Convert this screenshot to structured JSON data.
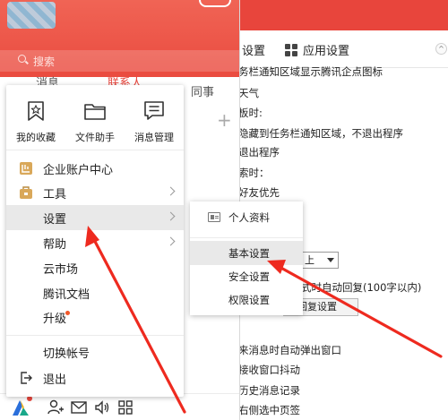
{
  "settings_window": {
    "tab_system": "设置",
    "tab_app": "应用设置",
    "scroll_button": "^",
    "rows": [
      "务栏通知区域显示腾讯企点图标",
      "天气",
      "板时:",
      "隐藏到任务栏通知区域，不退出程序",
      "退出程序",
      "索时：",
      "好友优先",
      "",
      "",
      "",
      "",
      "式时自动回复(100字以内)",
      "",
      "来消息时自动弹出窗口",
      "接收窗口抖动",
      "历史消息记录",
      "右侧选中页签"
    ],
    "select_value": "上",
    "quick_reply_button": "捷回复设置"
  },
  "qq_panel": {
    "search_placeholder": "搜索",
    "tabs": [
      "消息",
      "联系人",
      "同事"
    ]
  },
  "main_menu": {
    "quick_actions": [
      {
        "label": "我的收藏",
        "icon": "bookmark-icon"
      },
      {
        "label": "文件助手",
        "icon": "folder-icon"
      },
      {
        "label": "消息管理",
        "icon": "message-manage-icon"
      }
    ],
    "items": [
      {
        "label": "企业账户中心",
        "icon": "enterprise-account-icon"
      },
      {
        "label": "工具",
        "icon": "toolbox-icon",
        "has_submenu": true
      },
      {
        "label": "设置",
        "has_submenu": true,
        "active": true
      },
      {
        "label": "帮助",
        "has_submenu": true
      },
      {
        "label": "云市场"
      },
      {
        "label": "腾讯文档"
      },
      {
        "label": "升级",
        "badge_dot": true
      },
      {
        "label": "切换帐号"
      },
      {
        "label": "退出",
        "icon": "logout-icon"
      }
    ]
  },
  "sub_menu": {
    "items": [
      {
        "label": "个人资料",
        "icon": "profile-card-icon"
      },
      {
        "label": "基本设置",
        "hover": true
      },
      {
        "label": "安全设置"
      },
      {
        "label": "权限设置"
      }
    ]
  },
  "colors": {
    "brand_red": "#e8453c",
    "annotation_red": "#ee2a1f",
    "menu_hover": "#e9e9e9"
  }
}
